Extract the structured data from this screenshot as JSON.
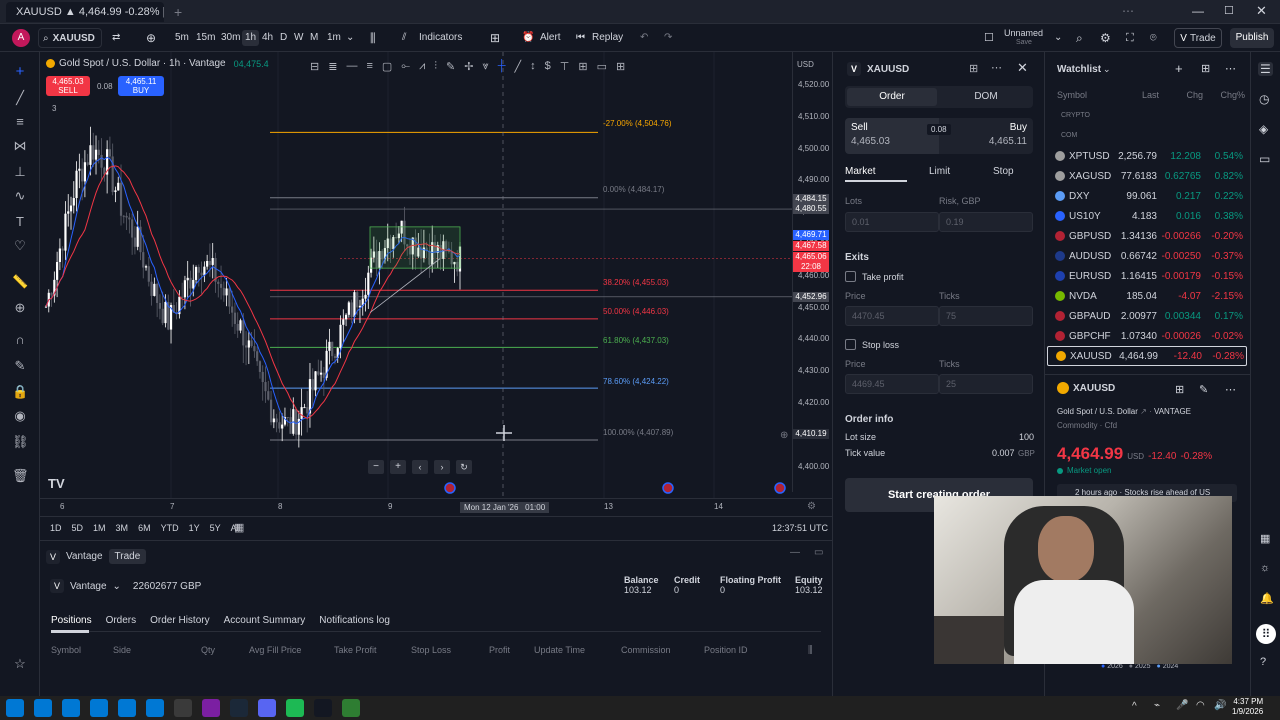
{
  "tab": {
    "title": "XAUUSD ▲ 4,464.99 -0.28% | U"
  },
  "toolbar": {
    "symbol": "XAUUSD",
    "intervals": [
      "5m",
      "15m",
      "30m",
      "1h",
      "4h",
      "D",
      "W",
      "M",
      "1m"
    ],
    "indicators": "Indicators",
    "alert": "Alert",
    "replay": "Replay",
    "layout_name": "Unnamed",
    "layout_sub": "Save",
    "trade": "Trade",
    "publish": "Publish"
  },
  "chart": {
    "legend": "Gold Spot / U.S. Dollar · 1h · Vantage",
    "legend_price": "04,475.4",
    "sell_price": "4,465.03",
    "sell_label": "SELL",
    "spread": "0.08",
    "buy_price": "4,465.11",
    "buy_label": "BUY",
    "indicator_count": "3",
    "price_axis": [
      "4,520.00",
      "4,510.00",
      "4,500.00",
      "4,490.00",
      "4,480.00",
      "4,470.00",
      "4,460.00",
      "4,450.00",
      "4,440.00",
      "4,430.00",
      "4,420.00",
      "4,410.00",
      "4,400.00"
    ],
    "currency": "USD",
    "price_tags": [
      {
        "text": "4,484.15",
        "color": "#434651"
      },
      {
        "text": "4,480.55",
        "color": "#434651"
      },
      {
        "text": "4,469.71",
        "color": "#2962ff"
      },
      {
        "text": "4,467.58",
        "color": "#f23645"
      },
      {
        "text": "4,465.06",
        "color": "#f23645"
      },
      {
        "text": "22:08",
        "color": "#f23645"
      },
      {
        "text": "4,452.96",
        "color": "#434651"
      },
      {
        "text": "4,410.19",
        "color": "#2a2e39"
      }
    ],
    "fib_levels": [
      {
        "label": "-27.00% (4,504.76)",
        "color": "#f7a600"
      },
      {
        "label": "0.00% (4,484.17)",
        "color": "#787b86"
      },
      {
        "label": "38.20% (4,455.03)",
        "color": "#f23645"
      },
      {
        "label": "50.00% (4,446.03)",
        "color": "#f23645"
      },
      {
        "label": "61.80% (4,437.03)",
        "color": "#4caf50"
      },
      {
        "label": "78.60% (4,424.22)",
        "color": "#5b9cf6"
      },
      {
        "label": "100.00% (4,407.89)",
        "color": "#787b86"
      }
    ],
    "time_axis": [
      "6",
      "7",
      "8",
      "9",
      "13",
      "14"
    ],
    "crosshair_time": "Mon 12 Jan '26   01:00",
    "ranges": [
      "1D",
      "5D",
      "1M",
      "3M",
      "6M",
      "YTD",
      "1Y",
      "5Y",
      "All"
    ],
    "clock": "12:37:51 UTC"
  },
  "order": {
    "symbol": "XAUUSD",
    "tab_order": "Order",
    "tab_dom": "DOM",
    "sell_label": "Sell",
    "sell_price": "4,465.03",
    "spread": "0.08",
    "buy_label": "Buy",
    "buy_price": "4,465.11",
    "types": [
      "Market",
      "Limit",
      "Stop"
    ],
    "lots_label": "Lots",
    "risk_label": "Risk, GBP",
    "lots_value": "0.01",
    "risk_value": "0.19",
    "exits": "Exits",
    "take_profit": "Take profit",
    "stop_loss": "Stop loss",
    "price_label": "Price",
    "ticks_label": "Ticks",
    "tp_price": "4470.45",
    "tp_ticks": "75",
    "sl_price": "4469.45",
    "sl_ticks": "25",
    "info_title": "Order info",
    "lot_size_label": "Lot size",
    "lot_size": "100",
    "tick_value_label": "Tick value",
    "tick_value": "0.007",
    "tick_cur": "GBP",
    "start_btn": "Start creating order"
  },
  "watchlist": {
    "title": "Watchlist",
    "cols": [
      "Symbol",
      "Last",
      "Chg",
      "Chg%"
    ],
    "groups": [
      "CRYPTO",
      "COM"
    ],
    "items": [
      {
        "sym": "XPTUSD",
        "last": "2,256.79",
        "chg": "12.208",
        "pct": "0.54%",
        "dir": "up",
        "icon": "#9e9e9e"
      },
      {
        "sym": "XAGUSD",
        "last": "77.6183",
        "chg": "0.62765",
        "pct": "0.82%",
        "dir": "up",
        "icon": "#9e9e9e"
      },
      {
        "sym": "DXY",
        "last": "99.061",
        "chg": "0.217",
        "pct": "0.22%",
        "dir": "up",
        "icon": "#5b9cf6"
      },
      {
        "sym": "US10Y",
        "last": "4.183",
        "chg": "0.016",
        "pct": "0.38%",
        "dir": "up",
        "icon": "#2962ff"
      },
      {
        "sym": "GBPUSD",
        "last": "1.34136",
        "chg": "-0.00266",
        "pct": "-0.20%",
        "dir": "down",
        "icon": "#b22234"
      },
      {
        "sym": "AUDUSD",
        "last": "0.66742",
        "chg": "-0.00250",
        "pct": "-0.37%",
        "dir": "down",
        "icon": "#1e3a8a"
      },
      {
        "sym": "EURUSD",
        "last": "1.16415",
        "chg": "-0.00179",
        "pct": "-0.15%",
        "dir": "down",
        "icon": "#1e40af"
      },
      {
        "sym": "NVDA",
        "last": "185.04",
        "chg": "-4.07",
        "pct": "-2.15%",
        "dir": "down",
        "icon": "#76b900"
      },
      {
        "sym": "GBPAUD",
        "last": "2.00977",
        "chg": "0.00344",
        "pct": "0.17%",
        "dir": "up",
        "icon": "#b22234"
      },
      {
        "sym": "GBPCHF",
        "last": "1.07340",
        "chg": "-0.00026",
        "pct": "-0.02%",
        "dir": "down",
        "icon": "#b22234"
      },
      {
        "sym": "XAUUSD",
        "last": "4,464.99",
        "chg": "-12.40",
        "pct": "-0.28%",
        "dir": "down",
        "icon": "#f2a900"
      }
    ],
    "detail_symbol": "XAUUSD",
    "detail_name": "Gold Spot / U.S. Dollar",
    "detail_exchange": "VANTAGE",
    "detail_type": "Commodity · Cfd",
    "detail_price": "4,464.99",
    "detail_cur": "USD",
    "detail_chg": "-12.40",
    "detail_pct": "-0.28%",
    "market_status": "Market open",
    "news": "2 hours ago · Stocks rise ahead of US",
    "years": [
      "2026",
      "2025",
      "2024"
    ]
  },
  "bottom": {
    "broker_tab": "Vantage",
    "trade_tab": "Trade",
    "account_broker": "Vantage",
    "account_id": "22602677 GBP",
    "balance_label": "Balance",
    "balance": "103.12",
    "credit_label": "Credit",
    "credit": "0",
    "floating_label": "Floating Profit",
    "floating": "0",
    "equity_label": "Equity",
    "equity": "103.12",
    "tabs": [
      "Positions",
      "Orders",
      "Order History",
      "Account Summary",
      "Notifications log"
    ],
    "cols": [
      "Symbol",
      "Side",
      "Qty",
      "Avg Fill Price",
      "Take Profit",
      "Stop Loss",
      "Profit",
      "Update Time",
      "Commission",
      "Position ID"
    ]
  },
  "taskbar": {
    "time": "4:37 PM",
    "date": "1/9/2026"
  }
}
